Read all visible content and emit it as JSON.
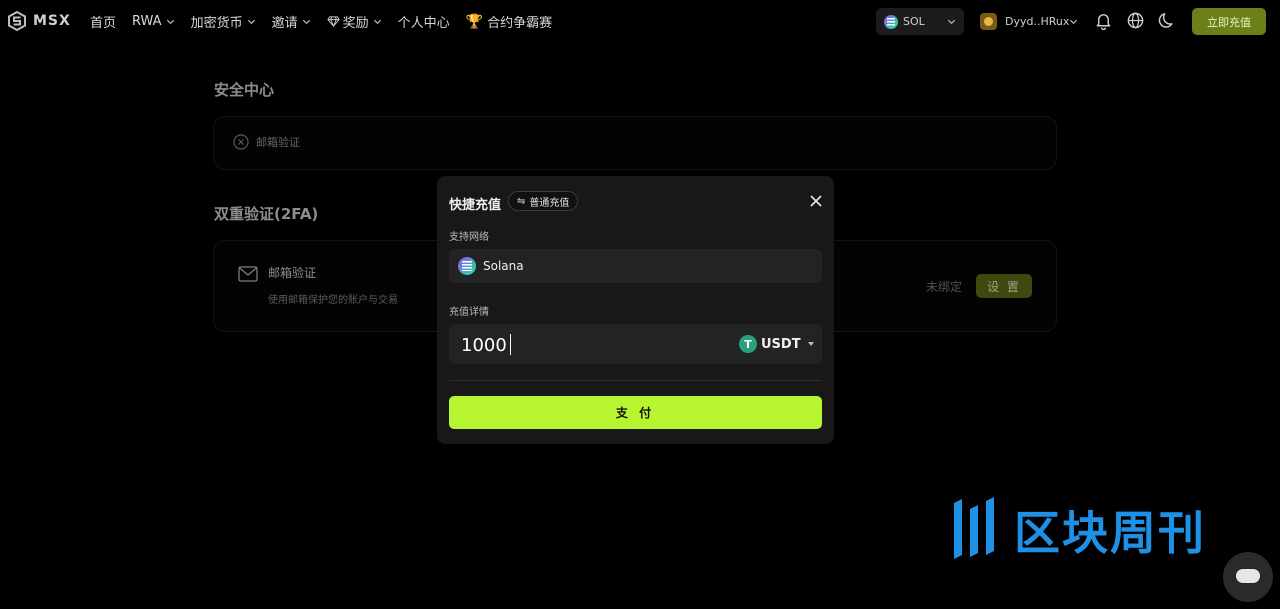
{
  "nav": {
    "logo_text": "MSX",
    "menu": [
      {
        "label": "首页",
        "has_chevron": false
      },
      {
        "label": "RWA",
        "has_chevron": true
      },
      {
        "label": "加密货币",
        "has_chevron": true
      },
      {
        "label": "邀请",
        "has_chevron": true
      },
      {
        "label": "奖励",
        "has_chevron": true,
        "icon": "gem-icon"
      },
      {
        "label": "个人中心",
        "has_chevron": false
      },
      {
        "label": "合约争霸赛",
        "has_chevron": false,
        "icon": "trophy-icon"
      }
    ],
    "network": "SOL",
    "account": "Dyyd..HRux",
    "deposit_button": "立即充值"
  },
  "security": {
    "title": "安全中心",
    "email_verify": "邮箱验证"
  },
  "twofa": {
    "title": "双重验证(2FA)",
    "item_name": "邮箱验证",
    "item_desc": "使用邮箱保护您的账户与交易",
    "status": "未绑定",
    "setup_button": "设 置"
  },
  "modal": {
    "title": "快捷充值",
    "normal_tab": "普通充值",
    "network_label": "支持网络",
    "network_value": "Solana",
    "details_label": "充值详情",
    "amount": "1000",
    "currency": "USDT",
    "pay_button": "支 付"
  },
  "watermark": {
    "text": "区块周刊"
  },
  "colors": {
    "accent": "#b8f531",
    "deposit": "#6b8018",
    "usdt": "#26a17b",
    "watermark": "#1e90e6"
  }
}
